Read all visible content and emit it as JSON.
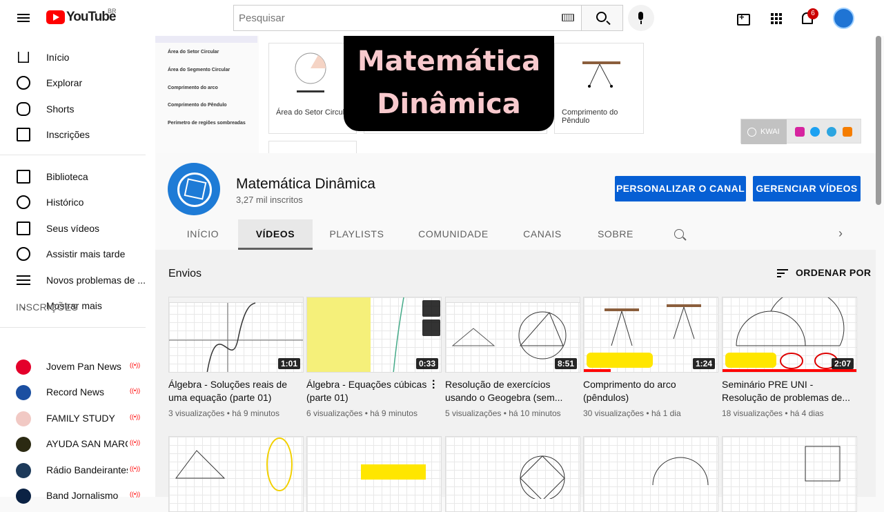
{
  "header": {
    "logo_text": "YouTube",
    "country": "BR",
    "search_placeholder": "Pesquisar",
    "notification_count": "6"
  },
  "sidebar": {
    "main": [
      {
        "label": "Início",
        "icon": "home-icon"
      },
      {
        "label": "Explorar",
        "icon": "compass-icon"
      },
      {
        "label": "Shorts",
        "icon": "shorts-icon"
      },
      {
        "label": "Inscrições",
        "icon": "subscriptions-icon"
      }
    ],
    "library": [
      {
        "label": "Biblioteca",
        "icon": "library-icon"
      },
      {
        "label": "Histórico",
        "icon": "history-icon"
      },
      {
        "label": "Seus vídeos",
        "icon": "your-videos-icon"
      },
      {
        "label": "Assistir mais tarde",
        "icon": "watch-later-icon"
      },
      {
        "label": "Novos problemas de ...",
        "icon": "playlist-icon"
      },
      {
        "label": "Mostrar mais",
        "icon": "chevron-down-icon"
      }
    ],
    "subscriptions_header": "INSCRIÇÕES",
    "subscriptions": [
      {
        "name": "Jovem Pan News",
        "color": "#e4002b"
      },
      {
        "name": "Record News",
        "color": "#1b4fa1"
      },
      {
        "name": "FAMILY STUDY",
        "color": "#f1c9c4"
      },
      {
        "name": "AYUDA SAN MARC...",
        "color": "#2b2a12"
      },
      {
        "name": "Rádio Bandeirantes",
        "color": "#1d3a5a"
      },
      {
        "name": "Band Jornalismo",
        "color": "#0b2244"
      }
    ]
  },
  "banner": {
    "side_items": [
      "Área do Setor Circular",
      "Área do Segmento Circular",
      "Comprimento do arco",
      "Comprimento do Pêndulo",
      "Perímetro de regiões sombreadas"
    ],
    "card_titles": [
      "Área do Setor Circular",
      "Comprimento do Pêndulo"
    ],
    "title_line1": "Matemática",
    "title_line2": "Dinâmica",
    "link_label": "KWAI"
  },
  "channel": {
    "name": "Matemática Dinâmica",
    "subscribers": "3,27 mil inscritos",
    "customize_button": "PERSONALIZAR O CANAL",
    "manage_button": "GERENCIAR VÍDEOS",
    "tabs": [
      "INÍCIO",
      "VÍDEOS",
      "PLAYLISTS",
      "COMUNIDADE",
      "CANAIS",
      "SOBRE"
    ],
    "active_tab": "VÍDEOS"
  },
  "uploads": {
    "section_title": "Envios",
    "sort_label": "ORDENAR POR",
    "videos": [
      {
        "title": "Álgebra - Soluções reais de uma equação (parte 01)",
        "duration": "1:01",
        "views": "3 visualizações",
        "age": "há 9 minutos"
      },
      {
        "title": "Álgebra - Equações cúbicas (parte 01)",
        "duration": "0:33",
        "views": "6 visualizações",
        "age": "há 9 minutos"
      },
      {
        "title": "Resolução de exercícios usando o Geogebra (sem...",
        "duration": "8:51",
        "views": "5 visualizações",
        "age": "há 10 minutos"
      },
      {
        "title": "Comprimento do arco (pêndulos)",
        "duration": "1:24",
        "views": "30 visualizações",
        "age": "há 1 dia"
      },
      {
        "title": "Seminário PRE UNI - Resolução de problemas de...",
        "duration": "2:07",
        "views": "18 visualizações",
        "age": "há 4 dias"
      }
    ]
  },
  "colors": {
    "accent": "#065fd4",
    "youtube_red": "#ff0000"
  }
}
